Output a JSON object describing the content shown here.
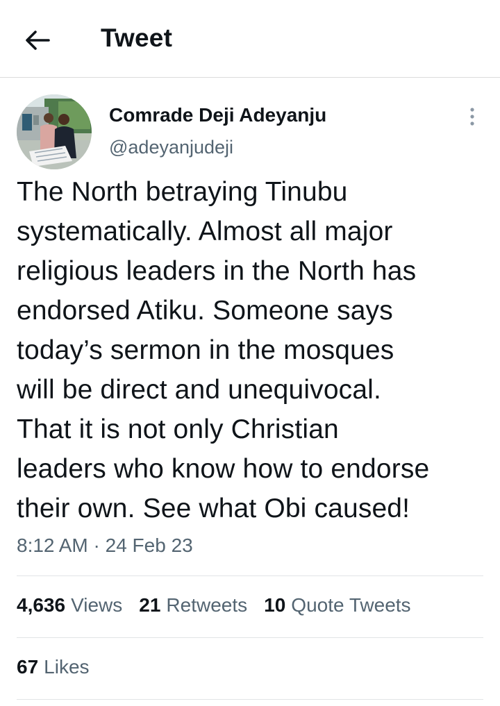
{
  "header": {
    "title": "Tweet",
    "back_icon": "arrow-left-icon"
  },
  "author": {
    "display_name": "Comrade Deji Adeyanju",
    "handle": "@adeyanjudeji",
    "avatar": "profile-photo",
    "more_icon": "vertical-ellipsis-icon"
  },
  "tweet": {
    "lines": [
      "The North betraying Tinubu",
      "systematically. Almost all major",
      "religious leaders in the North has",
      "endorsed Atiku. Someone says",
      "today’s sermon in the mosques",
      "will be direct and unequivocal.",
      "That it is not only Christian",
      "leaders who know how to endorse",
      "their own. See what Obi caused!"
    ],
    "time": "8:12 AM",
    "separator": "·",
    "date": "24 Feb 23"
  },
  "stats": {
    "views": {
      "count": "4,636",
      "label": "Views"
    },
    "retweets": {
      "count": "21",
      "label": "Retweets"
    },
    "quote_tweets": {
      "count": "10",
      "label": "Quote Tweets"
    },
    "likes": {
      "count": "67",
      "label": "Likes"
    }
  },
  "colors": {
    "text_primary": "#0f1419",
    "text_secondary": "#536471",
    "divider": "#e1e4e6"
  }
}
